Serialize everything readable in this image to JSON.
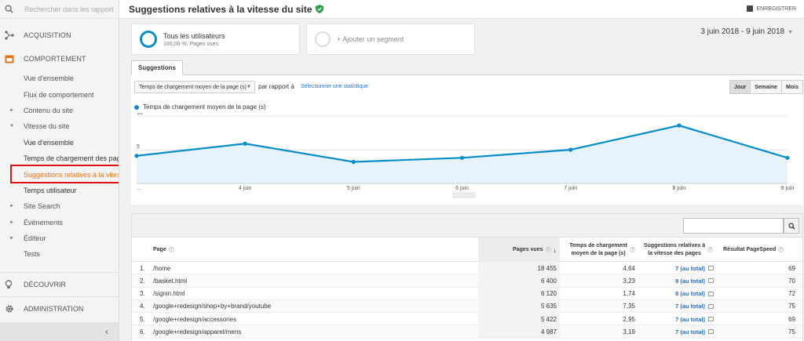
{
  "sidebar": {
    "search_placeholder": "Rechercher dans les rapport",
    "sections": {
      "acquisition": "ACQUISITION",
      "comportement": "COMPORTEMENT",
      "decouvrir": "DÉCOUVRIR",
      "administration": "ADMINISTRATION"
    },
    "items": [
      {
        "label": "Vue d'ensemble",
        "type": "l1"
      },
      {
        "label": "Flux de comportement",
        "type": "l1"
      },
      {
        "label": "Contenu du site",
        "type": "l1t",
        "tri": "►"
      },
      {
        "label": "Vitesse du site",
        "type": "l1t",
        "tri": "▼"
      },
      {
        "label": "Vue d'ensemble",
        "type": "l2"
      },
      {
        "label": "Temps de chargement des pages",
        "type": "l2"
      },
      {
        "label": "Suggestions relatives à la vitesse",
        "type": "l2",
        "active": true
      },
      {
        "label": "Temps utilisateur",
        "type": "l2"
      },
      {
        "label": "Site Search",
        "type": "l1t",
        "tri": "►"
      },
      {
        "label": "Événements",
        "type": "l1t",
        "tri": "►"
      },
      {
        "label": "Éditeur",
        "type": "l1t",
        "tri": "►"
      },
      {
        "label": "Tests",
        "type": "l1"
      }
    ]
  },
  "header": {
    "title": "Suggestions relatives à la vitesse du site",
    "save_label": "ENREGISTRER"
  },
  "segments": {
    "all_users_title": "Tous les utilisateurs",
    "all_users_sub": "100,00 %, Pages vues",
    "add_segment": "+ Ajouter un segment"
  },
  "daterange": "3 juin 2018 - 9 juin 2018",
  "tabs": {
    "suggestions": "Suggestions"
  },
  "controls": {
    "metric": "Temps de chargement moyen de la page (s)",
    "vs_label": "par rapport à",
    "choose_stat": "Sélectionner une statistique",
    "period": [
      "Jour",
      "Semaine",
      "Mois"
    ],
    "period_active": "Jour"
  },
  "chart_data": {
    "type": "area",
    "series": [
      {
        "name": "Temps de chargement moyen de la page (s)",
        "values": [
          4.1,
          5.9,
          3.2,
          3.8,
          5.0,
          8.6,
          3.8
        ]
      }
    ],
    "x_labels": [
      "...",
      "4 juin",
      "5 juin",
      "6 juin",
      "7 juin",
      "8 juin",
      "9 juin"
    ],
    "y_ticks": [
      5,
      10
    ],
    "ylim": [
      0,
      10
    ],
    "color": "#058dc7",
    "fill": "#e6f3fa"
  },
  "table": {
    "headers": {
      "page": "Page",
      "pageviews": "Pages vues",
      "load_time_1": "Temps de chargement",
      "load_time_2": "moyen de la page (s)",
      "sugg_1": "Suggestions relatives à",
      "sugg_2": "la vitesse des pages",
      "pagespeed": "Résultat PageSpeed"
    },
    "rows": [
      {
        "n": "1.",
        "page": "/home",
        "pv": "18 455",
        "lt": "4,64",
        "sugg": "7 (au total)",
        "ps": "69"
      },
      {
        "n": "2.",
        "page": "/basket.html",
        "pv": "6 400",
        "lt": "3,23",
        "sugg": "9 (au total)",
        "ps": "70"
      },
      {
        "n": "3.",
        "page": "/signin.html",
        "pv": "6 120",
        "lt": "1,74",
        "sugg": "8 (au total)",
        "ps": "72"
      },
      {
        "n": "4.",
        "page": "/google+redesign/shop+by+brand/youtube",
        "pv": "5 635",
        "lt": "7,35",
        "sugg": "7 (au total)",
        "ps": "75"
      },
      {
        "n": "5.",
        "page": "/google+redesign/accessories",
        "pv": "5 422",
        "lt": "2,95",
        "sugg": "7 (au total)",
        "ps": "69"
      },
      {
        "n": "6.",
        "page": "/google+redesign/apparel/mens",
        "pv": "4 987",
        "lt": "3,19",
        "sugg": "7 (au total)",
        "ps": "75"
      }
    ]
  }
}
